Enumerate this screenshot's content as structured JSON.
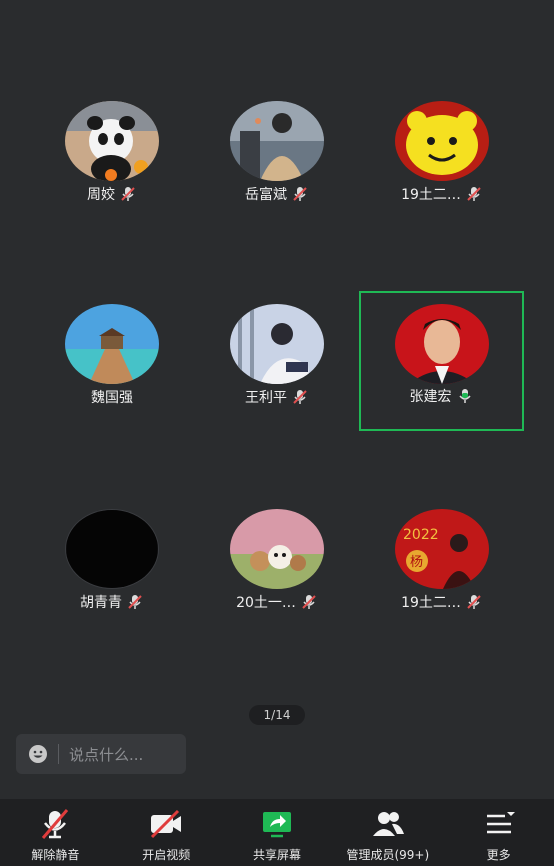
{
  "participants": [
    {
      "name": "周姣",
      "mic": "muted"
    },
    {
      "name": "岳富斌",
      "mic": "muted"
    },
    {
      "name": "19土二…",
      "mic": "muted"
    },
    {
      "name": "魏国强",
      "mic": "none"
    },
    {
      "name": "王利平",
      "mic": "muted"
    },
    {
      "name": "张建宏",
      "mic": "active"
    },
    {
      "name": "胡青青",
      "mic": "muted"
    },
    {
      "name": "20土一…",
      "mic": "muted"
    },
    {
      "name": "19土二…",
      "mic": "muted"
    }
  ],
  "pager": {
    "text": "1/14"
  },
  "chat": {
    "placeholder": "说点什么..."
  },
  "toolbar": {
    "unmute_label": "解除静音",
    "video_label": "开启视频",
    "share_label": "共享屏幕",
    "members_label": "管理成员(99+)",
    "more_label": "更多"
  },
  "colors": {
    "accent": "#1fb955",
    "muted": "#e05050",
    "background": "#2a2c2e"
  },
  "avatar_banner": {
    "year": "2022",
    "char": "杨"
  }
}
